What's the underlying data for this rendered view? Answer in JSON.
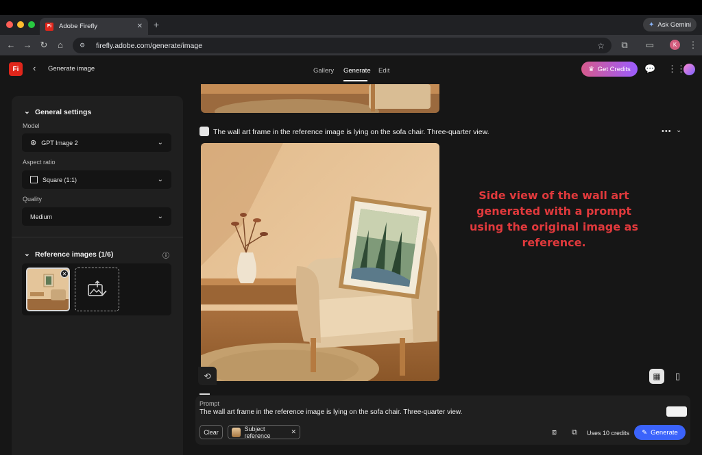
{
  "browser": {
    "tab_title": "Adobe Firefly",
    "tab_favicon": "Fi",
    "new_tab": "+",
    "gemini_label": "Ask Gemini",
    "url": "firefly.adobe.com/generate/image",
    "profile_initial": "K"
  },
  "header": {
    "logo": "Fi",
    "title": "Generate image",
    "tabs": [
      "Gallery",
      "Generate",
      "Edit"
    ],
    "active_tab": "Generate",
    "credits_label": "Get Credits"
  },
  "sidebar": {
    "general_title": "General settings",
    "model_label": "Model",
    "model_value": "GPT Image 2",
    "aspect_label": "Aspect ratio",
    "aspect_value": "Square (1:1)",
    "quality_label": "Quality",
    "quality_value": "Medium",
    "reference_title": "Reference images (1/6)"
  },
  "result": {
    "prompt_title": "The wall art frame in the reference image is lying on the sofa chair. Three-quarter view.",
    "annotation": "Side view of the wall art generated with a prompt using the original image as reference."
  },
  "prompt_bar": {
    "label": "Prompt",
    "text": "The wall art frame in the reference image is lying on the sofa chair. Three-quarter view.",
    "clear_label": "Clear",
    "subject_chip_label": "Subject reference",
    "uses_credits": "Uses 10 credits",
    "generate_label": "Generate"
  },
  "colors": {
    "accent_blue": "#3b63fb",
    "credits_gradient_start": "#d65a8c",
    "credits_gradient_end": "#9b5cff",
    "annotation_red": "#e0393c",
    "firefly_red": "#e0261b"
  }
}
